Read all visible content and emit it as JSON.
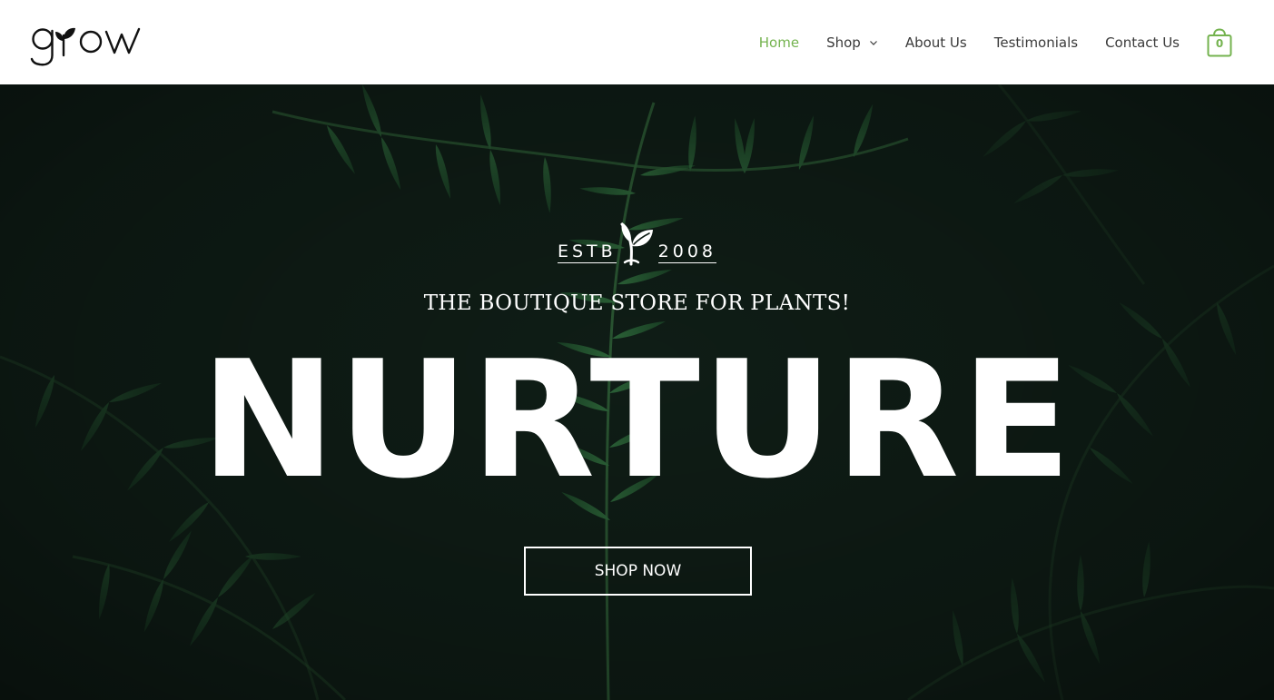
{
  "brand": {
    "logo_text": "grow",
    "accent_color": "#74b34f"
  },
  "nav": {
    "items": [
      {
        "label": "Home",
        "active": true
      },
      {
        "label": "Shop",
        "has_dropdown": true
      },
      {
        "label": "About Us"
      },
      {
        "label": "Testimonials"
      },
      {
        "label": "Contact Us"
      }
    ],
    "cart": {
      "icon": "shopping-bag-icon",
      "count": "0"
    }
  },
  "hero": {
    "background": "dark tropical fern leaves",
    "estb_left": "ESTB",
    "estb_right": "2008",
    "estb_icon": "sprout-icon",
    "tagline": "THE BOUTIQUE STORE FOR PLANTS!",
    "headline": "NURTURE",
    "cta_label": "SHOP NOW"
  }
}
